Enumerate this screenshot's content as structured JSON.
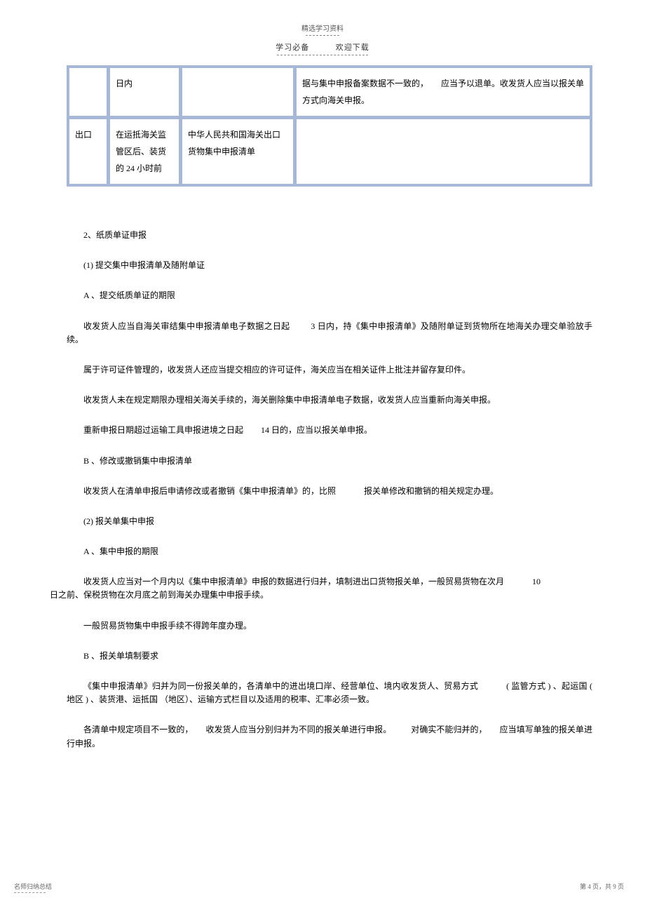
{
  "header": {
    "top": "精选学习资料",
    "left": "学习必备",
    "right": "欢迎下载"
  },
  "table": {
    "r1c2": "日内",
    "r1c4": "据与集中申报备案数据不一致的，　　应当予以退单。收发货人应当以报关单方式向海关申报。",
    "r2c1": "出口",
    "r2c2": "在运抵海关监管区后、装货的  24 小时前",
    "r2c3": "中华人民共和国海关出口货物集中申报清单"
  },
  "body": {
    "p1": "2、纸质单证申报",
    "p2": "(1) 提交集中申报清单及随附单证",
    "p3": "A 、提交纸质单证的期限",
    "p4a": "收发货人应当自海关审结集中申报清单电子数据之日起",
    "p4b": "3 日内，持《集中申报清单》及随附单证到货物所在地海关办理交单验放手续。",
    "p5": "属于许可证件管理的，收发货人还应当提交相应的许可证件，海关应当在相关证件上批注并留存复印件。",
    "p6": "收发货人未在规定期限办理相关海关手续的，海关删除集中申报清单电子数据，收发货人应当重新向海关申报。",
    "p7a": "重新申报日期超过运输工具申报进境之日起",
    "p7b": "14  日的，应当以报关单申报。",
    "p8": "B 、修改或撤销集中申报清单",
    "p9a": "收发货人在清单申报后申请修改或者撤销《集中申报清单》的，比照",
    "p9b": "报关单修改和撤销的相关规定办理。",
    "p10": "(2) 报关单集中申报",
    "p11": "A 、集中申报的期限",
    "p12a": "收发货人应当对一个月内以《集中申报清单》申报的数据进行归并，填制进出口货物报关单，一般贸易货物在次月",
    "p12b": "10",
    "p12c": "日之前、保税货物在次月底之前到海关办理集中申报手续。",
    "p13": "一般贸易货物集中申报手续不得跨年度办理。",
    "p14": "B 、报关单填制要求",
    "p15a": "《集中申报清单》归并为同一份报关单的，各清单中的进出境口岸、经营单位、境内收发货人、贸易方式",
    "p15b": "( 监管方式  ) 、起运国 ( 地区 ) 、装货港、运抵国 （地区）、运输方式栏目以及适用的税率、汇率必须一致。",
    "p16a": "各清单中规定项目不一致的，",
    "p16b": "收发货人应当分别归并为不同的报关单进行申报。",
    "p16c": "对确实不能归并的，",
    "p16d": "应当填写单独的报关单进行申报。"
  },
  "footer": {
    "left": "名师归纳总结",
    "right": "第  4 页，共 9 页"
  }
}
